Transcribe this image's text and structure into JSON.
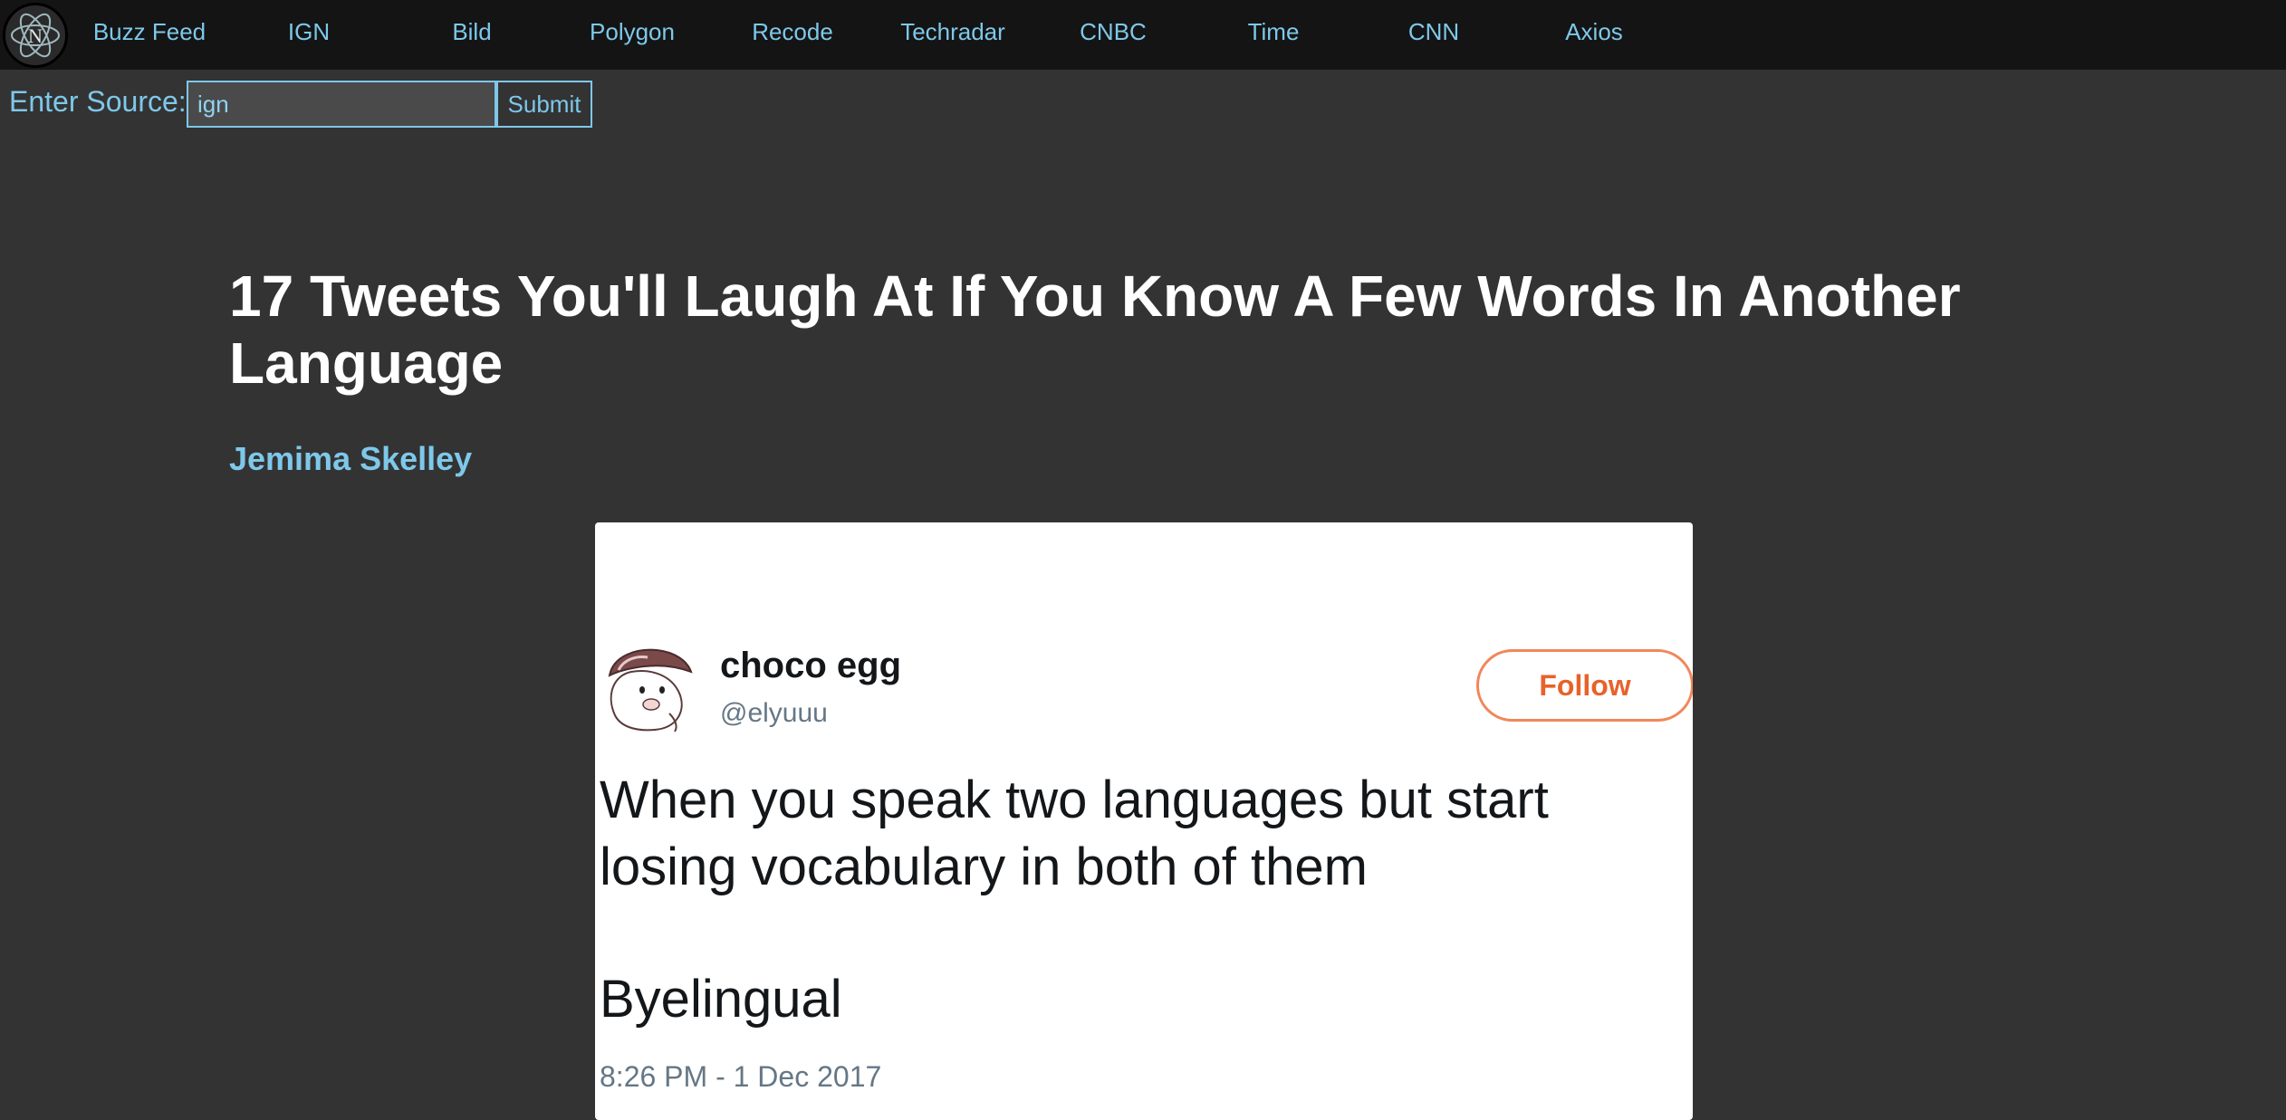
{
  "nav": {
    "items": [
      {
        "label": "Buzz Feed"
      },
      {
        "label": "IGN"
      },
      {
        "label": "Bild"
      },
      {
        "label": "Polygon"
      },
      {
        "label": "Recode"
      },
      {
        "label": "Techradar"
      },
      {
        "label": "CNBC"
      },
      {
        "label": "Time"
      },
      {
        "label": "CNN"
      },
      {
        "label": "Axios"
      }
    ]
  },
  "source_form": {
    "label": "Enter Source:",
    "input_value": "ign",
    "submit_label": "Submit"
  },
  "article": {
    "title": "17 Tweets You'll Laugh At If You Know A Few Words In Another Language",
    "author": "Jemima Skelley"
  },
  "tweet": {
    "name": "choco egg",
    "handle": "@elyuuu",
    "follow_label": "Follow",
    "text": "When you speak two languages but start\nlosing vocabulary in both of them",
    "punchline": "Byelingual",
    "timestamp": "8:26 PM - 1 Dec 2017"
  },
  "colors": {
    "background": "#333333",
    "topbar": "#141414",
    "accent": "#7ec8ea",
    "follow": "#e8622a"
  }
}
